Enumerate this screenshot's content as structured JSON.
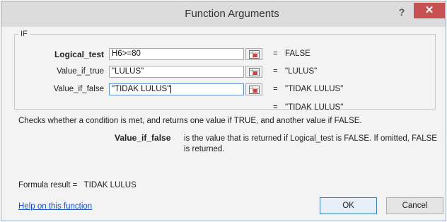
{
  "dialog": {
    "title": "Function Arguments",
    "help_glyph": "?",
    "close_glyph": "✕"
  },
  "function_name": "IF",
  "arguments": [
    {
      "label": "Logical_test",
      "value": "H6>=80",
      "result": "FALSE"
    },
    {
      "label": "Value_if_true",
      "value": "\"LULUS\"",
      "result": "\"LULUS\""
    },
    {
      "label": "Value_if_false",
      "value": "\"TIDAK LULUS\"",
      "result": "\"TIDAK LULUS\""
    }
  ],
  "equals_sign": "=",
  "overall_result": "\"TIDAK LULUS\"",
  "function_description": "Checks whether a condition is met, and returns one value if TRUE, and another value if FALSE.",
  "param_help": {
    "name": "Value_if_false",
    "description": "is the value that is returned if Logical_test is FALSE. If omitted, FALSE is returned."
  },
  "formula_result": {
    "label": "Formula result =",
    "value": "TIDAK LULUS"
  },
  "help_link": "Help on this function",
  "buttons": {
    "ok": "OK",
    "cancel": "Cancel"
  },
  "colors": {
    "close_button": "#c75050",
    "link": "#1a4fc4",
    "titlebar": "#dcdcdc"
  },
  "icons": {
    "collapse": "range-collapse-icon"
  }
}
